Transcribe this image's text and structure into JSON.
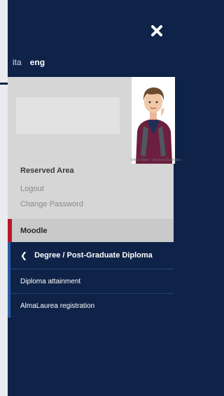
{
  "languages": {
    "ita": "ita",
    "eng": "eng"
  },
  "reserved_area": {
    "title": "Reserved Area",
    "logout": "Logout",
    "change_password": "Change Password"
  },
  "avatar_caption": "Ichiro Mario - Student Illustration",
  "moodle_label": "Moodle",
  "submenu": {
    "header": "Degree / Post-Graduate Diploma",
    "items": [
      "Diploma attainment",
      "AlmaLaurea registration"
    ]
  },
  "colors": {
    "navy": "#0f2348",
    "accent_red": "#b5172d",
    "accent_blue": "#2b5aa6"
  }
}
